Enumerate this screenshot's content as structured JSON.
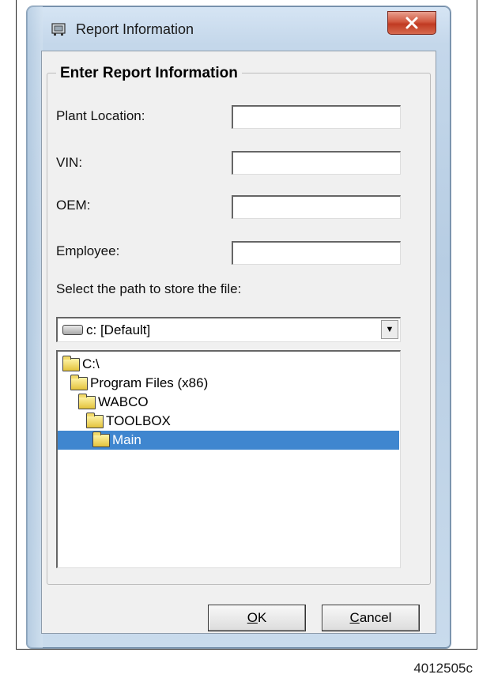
{
  "window": {
    "title": "Report Information",
    "close_icon": "close-x-icon",
    "app_icon": "report-app-icon"
  },
  "form": {
    "group_title": "Enter Report Information",
    "fields": [
      {
        "label": "Plant Location:",
        "value": ""
      },
      {
        "label": "VIN:",
        "value": ""
      },
      {
        "label": "OEM:",
        "value": ""
      },
      {
        "label": "Employee:",
        "value": ""
      }
    ],
    "path_label": "Select the path to store the file:",
    "drive_select": {
      "selected": "c: [Default]",
      "icon": "drive-icon"
    },
    "folder_tree": [
      {
        "label": "C:\\",
        "depth": 0,
        "selected": false
      },
      {
        "label": "Program Files (x86)",
        "depth": 1,
        "selected": false
      },
      {
        "label": "WABCO",
        "depth": 2,
        "selected": false
      },
      {
        "label": "TOOLBOX",
        "depth": 3,
        "selected": false
      },
      {
        "label": "Main",
        "depth": 4,
        "selected": true
      }
    ]
  },
  "buttons": {
    "ok": {
      "mnemonic": "O",
      "rest": "K"
    },
    "cancel": {
      "mnemonic": "C",
      "rest": "ancel"
    }
  },
  "figure_id": "4012505c",
  "colors": {
    "selection": "#3f86cf",
    "close_button": "#c9472e",
    "dialog_bg": "#f0f0f0"
  }
}
